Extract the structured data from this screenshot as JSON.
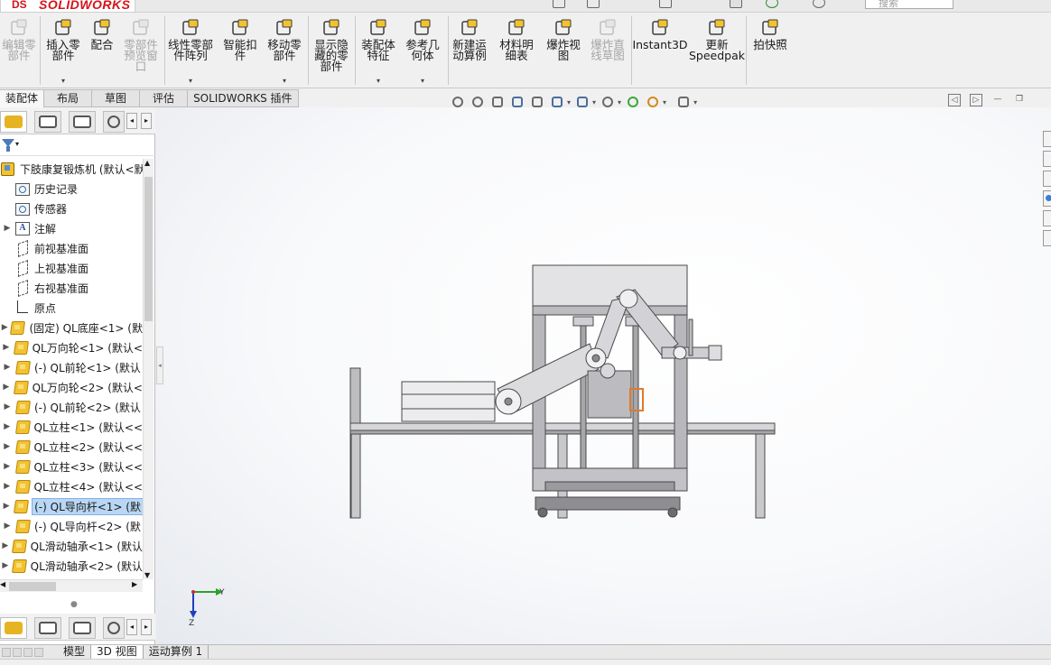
{
  "app": {
    "logo_ds": "DS",
    "logo_text": "SOLIDWORKS"
  },
  "search": {
    "placeholder": "搜索"
  },
  "commands": [
    {
      "label": "编辑零\n部件",
      "disabled": true,
      "icon": "edit-component-icon"
    },
    {
      "label": "插入零\n部件",
      "disabled": false,
      "icon": "insert-component-icon",
      "dropdown": true
    },
    {
      "label": "配合",
      "disabled": false,
      "icon": "mate-icon"
    },
    {
      "label": "零部件\n预览窗\n口",
      "disabled": true,
      "icon": "component-preview-icon"
    },
    {
      "label": "线性零部\n件阵列",
      "disabled": false,
      "icon": "linear-pattern-icon",
      "dropdown": true
    },
    {
      "label": "智能扣\n件",
      "disabled": false,
      "icon": "smart-fasteners-icon"
    },
    {
      "label": "移动零\n部件",
      "disabled": false,
      "icon": "move-component-icon",
      "dropdown": true
    },
    {
      "label": "显示隐\n藏的零\n部件",
      "disabled": false,
      "icon": "show-hidden-icon"
    },
    {
      "label": "装配体\n特征",
      "disabled": false,
      "icon": "assembly-features-icon",
      "dropdown": true
    },
    {
      "label": "参考几\n何体",
      "disabled": false,
      "icon": "reference-geometry-icon",
      "dropdown": true
    },
    {
      "label": "新建运\n动算例",
      "disabled": false,
      "icon": "motion-study-icon"
    },
    {
      "label": "材料明\n细表",
      "disabled": false,
      "icon": "bom-icon"
    },
    {
      "label": "爆炸视\n图",
      "disabled": false,
      "icon": "exploded-view-icon"
    },
    {
      "label": "爆炸直\n线草图",
      "disabled": true,
      "icon": "explode-line-sketch-icon"
    },
    {
      "label": "Instant3D",
      "disabled": false,
      "icon": "instant3d-icon"
    },
    {
      "label": "更新\nSpeedpak",
      "disabled": false,
      "icon": "speedpak-icon"
    },
    {
      "label": "拍快照",
      "disabled": false,
      "icon": "snapshot-icon"
    }
  ],
  "cmd_tabs": [
    "装配体",
    "布局",
    "草图",
    "评估",
    "SOLIDWORKS 插件"
  ],
  "tree": {
    "root": "下肢康复锻炼机 (默认<默",
    "items": [
      {
        "label": "历史记录",
        "icon": "folder",
        "arrow": ""
      },
      {
        "label": "传感器",
        "icon": "folder",
        "arrow": ""
      },
      {
        "label": "注解",
        "icon": "annot",
        "arrow": "▶"
      },
      {
        "label": "前视基准面",
        "icon": "plane",
        "arrow": ""
      },
      {
        "label": "上视基准面",
        "icon": "plane",
        "arrow": ""
      },
      {
        "label": "右视基准面",
        "icon": "plane",
        "arrow": ""
      },
      {
        "label": "原点",
        "icon": "origin",
        "arrow": ""
      },
      {
        "label": "(固定) QL底座<1> (默",
        "icon": "part",
        "arrow": "▶"
      },
      {
        "label": "QL万向轮<1> (默认<",
        "icon": "part",
        "arrow": "▶"
      },
      {
        "label": "(-) QL前轮<1> (默认",
        "icon": "part",
        "arrow": "▶"
      },
      {
        "label": "QL万向轮<2> (默认<",
        "icon": "part",
        "arrow": "▶"
      },
      {
        "label": "(-) QL前轮<2> (默认",
        "icon": "part",
        "arrow": "▶"
      },
      {
        "label": "QL立柱<1> (默认<<",
        "icon": "part",
        "arrow": "▶"
      },
      {
        "label": "QL立柱<2> (默认<<",
        "icon": "part",
        "arrow": "▶"
      },
      {
        "label": "QL立柱<3> (默认<<",
        "icon": "part",
        "arrow": "▶"
      },
      {
        "label": "QL立柱<4> (默认<<",
        "icon": "part",
        "arrow": "▶"
      },
      {
        "label": "(-) QL导向杆<1> (默",
        "icon": "part",
        "arrow": "▶",
        "selected": true
      },
      {
        "label": "(-) QL导向杆<2> (默",
        "icon": "part",
        "arrow": "▶"
      },
      {
        "label": "QL滑动轴承<1> (默认",
        "icon": "part",
        "arrow": "▶"
      },
      {
        "label": "QL滑动轴承<2> (默认",
        "icon": "part",
        "arrow": "▶"
      }
    ]
  },
  "bottom_tabs": [
    "模型",
    "3D 视图",
    "运动算例 1"
  ],
  "triad": {
    "y": "Y",
    "z": "Z"
  }
}
